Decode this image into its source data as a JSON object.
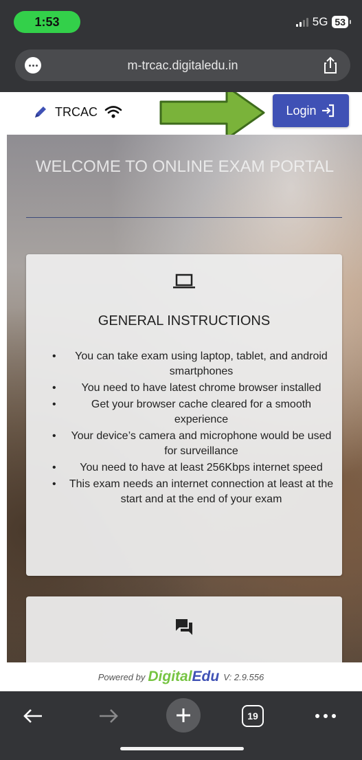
{
  "status_bar": {
    "time": "1:53",
    "network": "5G",
    "battery": "53"
  },
  "browser": {
    "url": "m-trcac.digitaledu.in",
    "tabs_count": "19"
  },
  "header": {
    "brand": "TRCAC",
    "login_label": "Login"
  },
  "hero": {
    "title": "WELCOME TO ONLINE EXAM PORTAL"
  },
  "instructions": {
    "title": "GENERAL INSTRUCTIONS",
    "items": [
      "You can take exam using laptop, tablet, and android smartphones",
      "You need to have latest chrome browser installed",
      "Get your browser cache cleared for a smooth experience",
      "Your device’s camera and microphone would be used for surveillance",
      "You need to have at least 256Kbps internet speed",
      "This exam needs an internet connection at least at the start and at the end of your exam"
    ]
  },
  "footer": {
    "powered_by": "Powered by",
    "brand_part1": "Digital",
    "brand_part2": "Edu",
    "version": "V: 2.9.556"
  },
  "colors": {
    "primary": "#3f51b5",
    "accent_green": "#76c442",
    "status_pill": "#33d04a",
    "annotation_arrow": "#7ab33a"
  },
  "icons": [
    "pencil-icon",
    "wifi-icon",
    "login-icon",
    "laptop-icon",
    "forum-icon",
    "back-icon",
    "forward-icon",
    "new-tab-icon",
    "share-icon",
    "more-icon"
  ]
}
